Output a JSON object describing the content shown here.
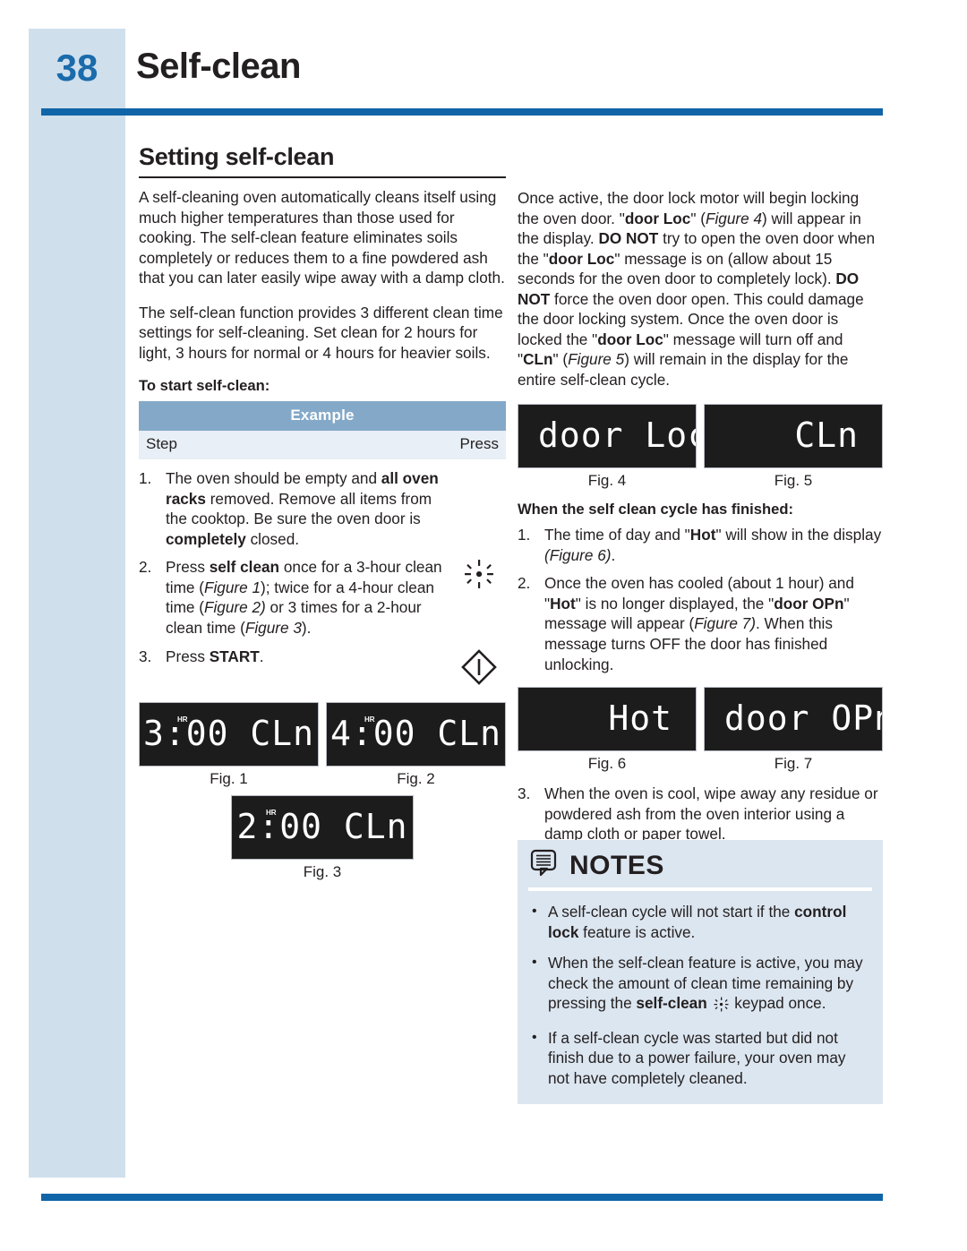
{
  "page": {
    "number": "38",
    "title": "Self-clean"
  },
  "left_column": {
    "section_title": "Setting self-clean",
    "paragraphs": [
      "A self-cleaning oven automatically cleans itself using much higher temperatures than those used for cooking. The self-clean feature eliminates soils completely or reduces them to a fine powdered ash that you can later easily wipe away with a damp cloth.",
      "The self-clean function provides 3 different clean time settings for self-cleaning. Set clean for 2 hours for light, 3 hours for normal or 4 hours for heavier soils."
    ],
    "lead_in": "To start self-clean:",
    "table": {
      "header": "Example",
      "col_step": "Step",
      "col_press": "Press"
    },
    "steps": [
      {
        "number": "1.",
        "html": "The oven should be empty and <b>all oven racks</b> removed. Remove all items from the cooktop. Be sure the oven door is <b>completely</b> closed.",
        "icon": "none"
      },
      {
        "number": "2.",
        "html": "Press <b>self clean</b> once for a 3-hour clean time (<i>Figure 1</i>); twice for a 4-hour clean time (<i>Figure 2)</i> or 3 times for a 2-hour clean time (<i>Figure 3</i>).",
        "icon": "self-clean-starburst-icon"
      },
      {
        "number": "3.",
        "html": "Press <b>START</b>.",
        "icon": "start-diamond-icon"
      }
    ],
    "figures": [
      {
        "id": "fig1",
        "display": "3:00 CLn",
        "hr_tag": "HR",
        "caption": "Fig. 1",
        "align": "center"
      },
      {
        "id": "fig2",
        "display": "4:00 CLn",
        "hr_tag": "HR",
        "caption": "Fig. 2",
        "align": "center"
      },
      {
        "id": "fig3",
        "display": "2:00 CLn",
        "hr_tag": "HR",
        "caption": "Fig. 3",
        "align": "center"
      }
    ]
  },
  "right_column": {
    "paragraph_html": "Once active, the door lock motor will begin locking the oven door. \"<b>door Loc</b>\" (<i>Figure 4</i>) will appear in the display. <b>DO NOT</b> try to open the oven door when the \"<b>door Loc</b>\" message is on (allow about 15 seconds for the oven door to completely lock). <b>DO NOT</b> force the oven door open. This could damage the door locking system. Once the oven door is locked the \"<b>door Loc</b>\" message will turn off and \"<b>CLn</b>\" (<i>Figure 5</i>) will remain in the display for the entire self-clean cycle.",
    "figures_top": [
      {
        "id": "fig4",
        "display": "door Loc",
        "caption": "Fig. 4",
        "align": "left"
      },
      {
        "id": "fig5",
        "display": "CLn",
        "caption": "Fig. 5",
        "align": "right"
      }
    ],
    "lead_in": "When the self clean cycle has finished:",
    "steps": [
      {
        "number": "1.",
        "html": "The time of day and \"<b>Hot</b>\" will show in the display <i>(Figure 6)</i>."
      },
      {
        "number": "2.",
        "html": "Once the oven has cooled (about 1 hour) and \"<b>Hot</b>\" is no longer displayed, the \"<b>door OPn</b>\" message will appear (<i>Figure 7)</i>.  When this message turns OFF the door has finished unlocking."
      }
    ],
    "figures_bottom": [
      {
        "id": "fig6",
        "display": "Hot",
        "caption": "Fig. 6",
        "align": "right"
      },
      {
        "id": "fig7",
        "display": "door OPn",
        "caption": "Fig. 7",
        "align": "left"
      }
    ],
    "step3": {
      "number": "3.",
      "html": "When the oven is cool, wipe away any residue or powdered ash from the oven interior using a damp cloth or paper towel."
    }
  },
  "notes": {
    "title": "NOTES",
    "icon": "notes-speech-bubble-icon",
    "items": [
      {
        "bullet": "•",
        "html": "A self-clean cycle will not start if the <b>control lock</b> feature is active."
      },
      {
        "bullet": "•",
        "html": "When the self-clean feature is active, you may check the amount of clean time remaining by pressing the <b>self-clean</b> <span class=\"inline-icon\" data-name=\"self-clean-starburst-icon\"></span> keypad once."
      },
      {
        "bullet": "•",
        "html": "If a self-clean cycle was started but did not finish due to a power failure, your oven may not have completely cleaned."
      }
    ]
  },
  "colors": {
    "brand_blue": "#1064a8",
    "page_number_blue": "#1a6bab",
    "strip_light_blue": "#cfdfec",
    "table_header_blue": "#84a9c8",
    "table_subrow_blue": "#e8eff6",
    "notes_bg": "#dce6f0",
    "led_bg": "#1c1c1c",
    "led_text": "#ffffff"
  }
}
